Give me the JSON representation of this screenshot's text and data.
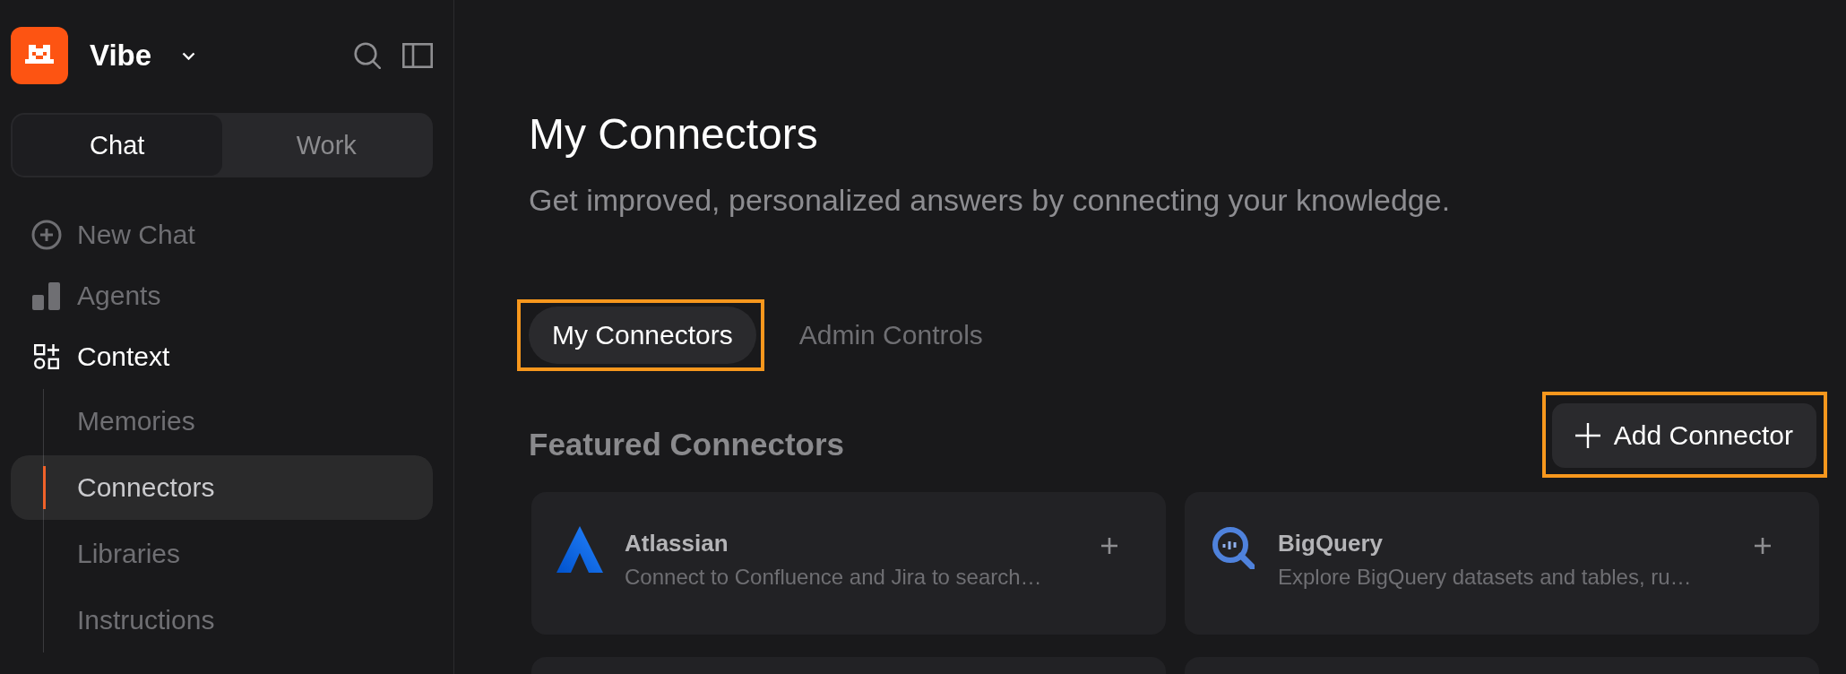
{
  "sidebar": {
    "workspace": {
      "name": "Vibe"
    },
    "modes": [
      {
        "label": "Chat",
        "selected": true
      },
      {
        "label": "Work",
        "selected": false
      }
    ],
    "items": [
      {
        "label": "New Chat",
        "selected": false,
        "faded": true
      },
      {
        "label": "Agents",
        "selected": false,
        "faded": true
      },
      {
        "label": "Context",
        "selected": false,
        "faded": false,
        "children": [
          {
            "label": "Memories",
            "selected": false,
            "faded": true
          },
          {
            "label": "Connectors",
            "selected": true,
            "faded": false
          },
          {
            "label": "Libraries",
            "selected": false,
            "faded": true
          },
          {
            "label": "Instructions",
            "selected": false,
            "faded": true
          }
        ]
      }
    ]
  },
  "page": {
    "title": "My Connectors",
    "subtitle": "Get improved, personalized answers by connecting your knowledge."
  },
  "tabs": [
    {
      "label": "My Connectors",
      "selected": true,
      "highlighted": true,
      "faded": false
    },
    {
      "label": "Admin Controls",
      "selected": false,
      "highlighted": false,
      "faded": true
    }
  ],
  "featured": {
    "heading": {
      "text": "Featured Connectors",
      "faded": true
    },
    "add_button": {
      "label": "Add Connector",
      "highlighted": true
    },
    "cards": [
      {
        "kind": "connector",
        "name": "Atlassian",
        "description": "Connect to Confluence and Jira to search…",
        "faded": true
      },
      {
        "kind": "connector",
        "name": "BigQuery",
        "description": "Explore BigQuery datasets and tables, ru…",
        "faded": true
      },
      {
        "kind": "clipped"
      },
      {
        "kind": "clipped"
      }
    ]
  }
}
